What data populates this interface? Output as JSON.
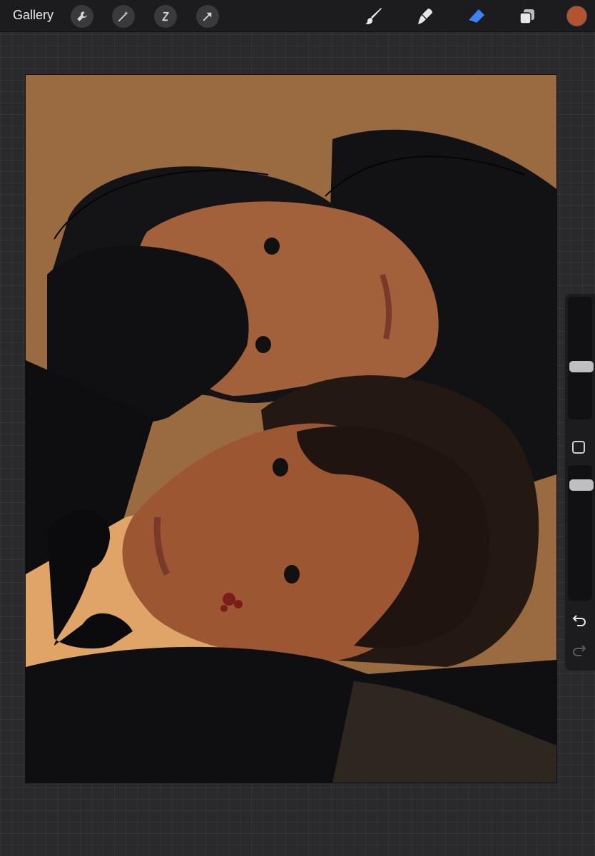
{
  "app": {
    "gallery_label": "Gallery"
  },
  "toolbar": {
    "left_tools": [
      "wrench-icon",
      "magic-wand-icon",
      "selection-icon",
      "transform-arrow-icon"
    ],
    "right_tools": [
      "brush-icon",
      "smudge-icon",
      "eraser-icon",
      "layers-icon"
    ],
    "active_tool": "eraser-icon",
    "active_tool_color": "#3b82f6",
    "current_color": "#b5532e"
  },
  "sidebar": {
    "brush_size_level": 0.35,
    "opacity_level": 0.1,
    "icons": [
      "modify-button-icon",
      "undo-icon",
      "redo-icon"
    ]
  },
  "canvas": {
    "background_color": "#9a6a40",
    "artwork_description_colors": {
      "background": "#9a6a40",
      "hair_dark": "#141316",
      "hair_brown": "#241813",
      "skin": "#a05a34",
      "shirt_light": "#e1a467",
      "suit": "#0f0f12"
    }
  }
}
